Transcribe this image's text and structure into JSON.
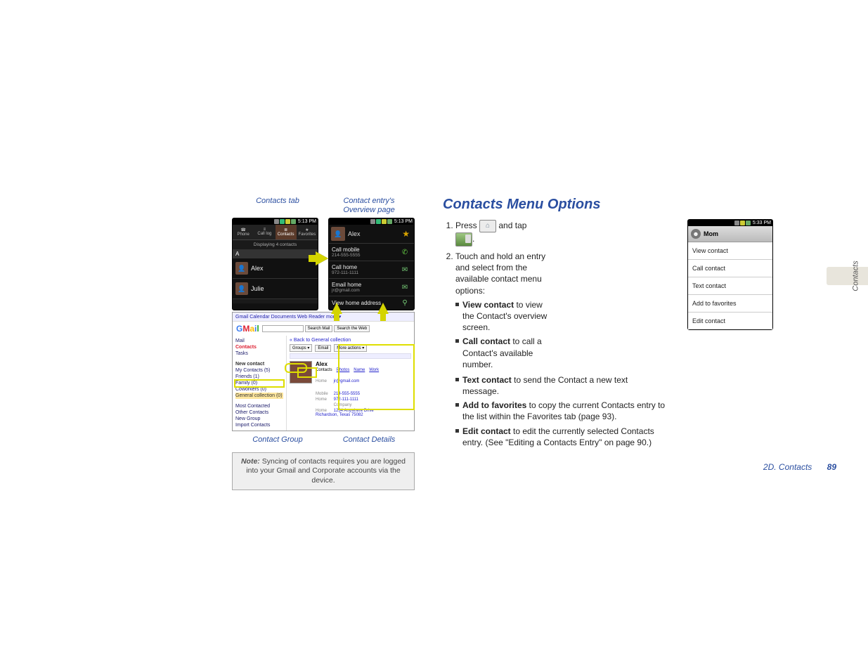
{
  "captions": {
    "contacts_tab": "Contacts tab",
    "overview_page_l1": "Contact entry's",
    "overview_page_l2": "Overview page",
    "contact_group": "Contact Group",
    "contact_details": "Contact Details"
  },
  "phone_common": {
    "time": "5:13 PM"
  },
  "phone_contacts": {
    "subtitle": "Displaying 4 contacts",
    "letter": "A",
    "tabs": {
      "phone": "Phone",
      "calllog": "Call log",
      "contacts": "Contacts",
      "favorites": "Favorites"
    },
    "items": [
      {
        "name": "Alex"
      },
      {
        "name": "Julie"
      }
    ]
  },
  "phone_overview": {
    "name": "Alex",
    "rows": [
      {
        "title": "Call mobile",
        "sub": "214-555-5555"
      },
      {
        "title": "Call home",
        "sub": "972-111-1111"
      },
      {
        "title": "Email home",
        "sub": "jr@gmail.com"
      },
      {
        "title": "View home address",
        "sub": ""
      }
    ],
    "action_icons": [
      "phone-icon",
      "sms-icon",
      "mail-icon",
      "map-icon"
    ]
  },
  "gmail": {
    "topbar": "Gmail  Calendar  Documents  Web  Reader  more ▾",
    "search_mail_btn": "Search Mail",
    "search_web_btn": "Search the Web",
    "side": {
      "mail": "Mail",
      "contacts": "Contacts",
      "tasks": "Tasks",
      "new_contact": "New contact",
      "groups": [
        "My Contacts (5)",
        "Friends (1)",
        "Family (0)",
        "Coworkers (0)",
        "General collection (0)"
      ],
      "groups2": [
        "Most Contacted",
        "Other Contacts",
        "New Group",
        "Import Contacts"
      ]
    },
    "main": {
      "back": "« Back to General collection",
      "buttons": [
        "Groups ▾",
        "Email",
        "More actions ▾"
      ],
      "name": "Alex",
      "tabs": [
        "Contacts",
        "Photos",
        "Name",
        "Work"
      ],
      "rows": [
        {
          "lbl": "Home",
          "val": "jr@gmail.com"
        },
        {
          "lbl": "Mobile",
          "val": "214-555-5555"
        },
        {
          "lbl": "Home",
          "val": "972-111-1111"
        },
        {
          "lbl": "",
          "val": "Company"
        },
        {
          "lbl": "Home",
          "val": "1234 Anywhere Drive\nRichardson, Texas 75082"
        }
      ]
    }
  },
  "note": {
    "label": "Note:",
    "text": "Syncing of contacts requires you are logged into your Gmail and Corporate accounts via the device."
  },
  "heading": "Contacts Menu Options",
  "steps": {
    "s1_a": "Press",
    "s1_b": "and tap",
    "s1_c": ".",
    "s2": "Touch and hold an entry and select from the available contact menu options:"
  },
  "bullets": {
    "b1_bold": "View contact",
    "b1_rest": " to view the Contact's overview screen.",
    "b2_bold": "Call contact",
    "b2_rest": " to call a Contact's available number.",
    "b3_bold": "Text contact",
    "b3_rest": " to send the Contact a new text message.",
    "b4_bold": "Add to favorites",
    "b4_rest": " to copy the current Contacts entry to the list within the Favorites tab (page 93).",
    "b5_bold": "Edit contact",
    "b5_rest": " to edit the currently selected Contacts entry. (See \"Editing a Contacts Entry\" on page 90.)"
  },
  "menu_phone": {
    "time": "5:33 PM",
    "header": "Mom",
    "items": [
      "View contact",
      "Call contact",
      "Text contact",
      "Add to favorites",
      "Edit contact"
    ]
  },
  "side_tab": "Contacts",
  "footer": {
    "section": "2D. Contacts",
    "page": "89"
  }
}
